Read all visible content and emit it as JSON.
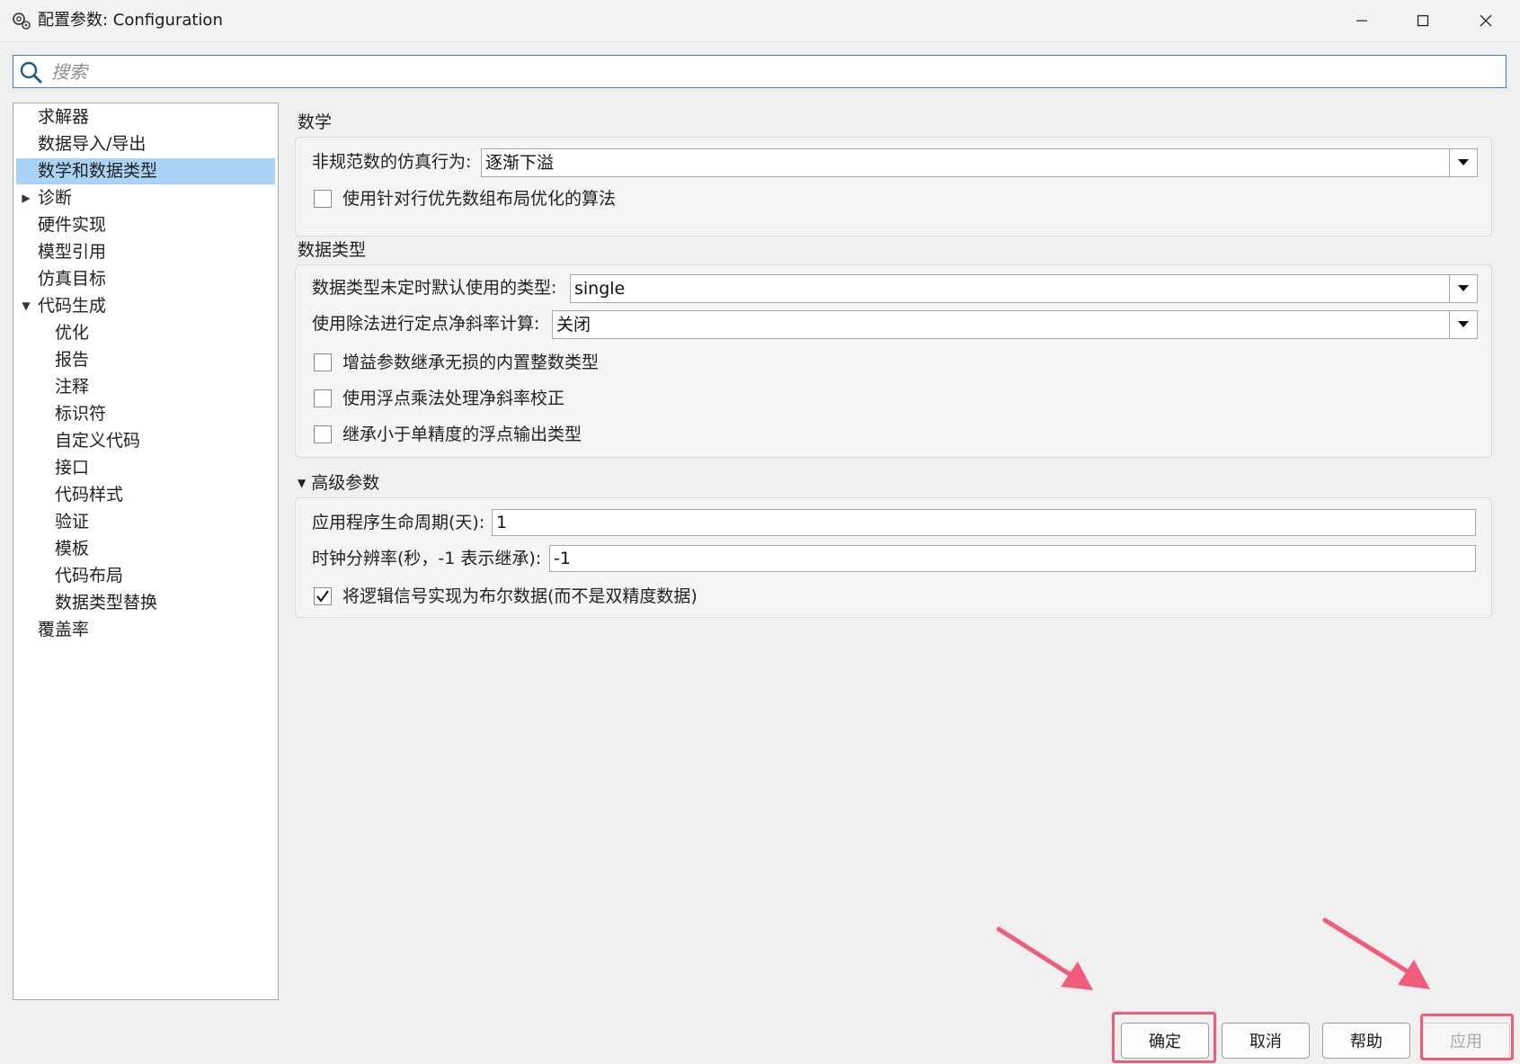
{
  "window": {
    "title": "配置参数: Configuration",
    "icon": "gear-icon"
  },
  "search": {
    "placeholder": "搜索",
    "value": ""
  },
  "tree": {
    "items": [
      {
        "label": "求解器"
      },
      {
        "label": "数据导入/导出"
      },
      {
        "label": "数学和数据类型",
        "selected": true
      },
      {
        "label": "诊断",
        "expander": "collapsed"
      },
      {
        "label": "硬件实现"
      },
      {
        "label": "模型引用"
      },
      {
        "label": "仿真目标"
      },
      {
        "label": "代码生成",
        "expander": "expanded"
      },
      {
        "label": "优化"
      },
      {
        "label": "报告"
      },
      {
        "label": "注释"
      },
      {
        "label": "标识符"
      },
      {
        "label": "自定义代码"
      },
      {
        "label": "接口"
      },
      {
        "label": "代码样式"
      },
      {
        "label": "验证"
      },
      {
        "label": "模板"
      },
      {
        "label": "代码布局"
      },
      {
        "label": "数据类型替换"
      },
      {
        "label": "覆盖率"
      }
    ]
  },
  "math": {
    "title": "数学",
    "denormal_label": "非规范数的仿真行为:",
    "denormal_value": "逐渐下溢",
    "row_major_label": "使用针对行优先数组布局优化的算法",
    "row_major_checked": false
  },
  "data_types": {
    "title": "数据类型",
    "default_type_label": "数据类型未定时默认使用的类型:",
    "default_type_value": "single",
    "division_label": "使用除法进行定点净斜率计算:",
    "division_value": "关闭",
    "gain_label": "增益参数继承无损的内置整数类型",
    "gain_checked": false,
    "float_mult_label": "使用浮点乘法处理净斜率校正",
    "float_mult_checked": false,
    "inherit_label": "继承小于单精度的浮点输出类型",
    "inherit_checked": false
  },
  "advanced": {
    "title": "高级参数",
    "lifespan_label": "应用程序生命周期(天):",
    "lifespan_value": "1",
    "clock_label": "时钟分辨率(秒，-1 表示继承):",
    "clock_value": "-1",
    "boolean_label": "将逻辑信号实现为布尔数据(而不是双精度数据)",
    "boolean_checked": true
  },
  "footer": {
    "ok": "确定",
    "cancel": "取消",
    "help": "帮助",
    "apply": "应用"
  },
  "colors": {
    "selection": "#a9d4f7",
    "search_border": "#3b7fc4",
    "annotation": "#f05c7c"
  }
}
